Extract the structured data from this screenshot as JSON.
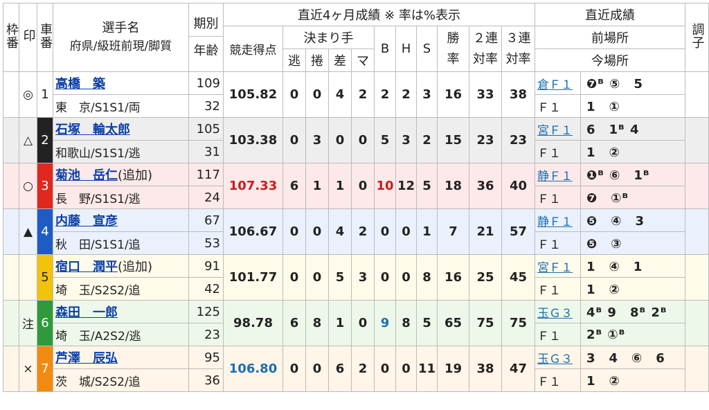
{
  "header": {
    "waku": "枠番",
    "shirushi": "印",
    "shaban": "車番",
    "name_top": "選手名",
    "name_bottom": "府県/級班前現/脚質",
    "kibetsu": "期別",
    "nenrei": "年齢",
    "recent4": "直近4ヶ月成績 ※ 率は%表示",
    "score": "競走得点",
    "kimarite": "決まり手",
    "nige": "逃",
    "makuri": "捲",
    "sashi": "差",
    "mark": "マ",
    "b": "B",
    "h": "H",
    "s": "S",
    "win_top": "勝",
    "win_bottom": "率",
    "ren2_top": "２連",
    "ren2_bottom": "対率",
    "ren3_top": "３連",
    "ren3_bottom": "対率",
    "recent_results": "直近成績",
    "prev_venue": "前場所",
    "this_venue": "今場所",
    "condition": "調子"
  },
  "colors": {
    "car1": "#ffffff",
    "car2": "#222222",
    "car3": "#e0281e",
    "car4": "#1e5bc6",
    "car5": "#f2c20d",
    "car6": "#2e9a3c",
    "car7": "#f28a12",
    "row1": "#ffffff",
    "row2": "#eeeeee",
    "row3": "#fde9e9",
    "row4": "#eaf1fc",
    "row5": "#fffbea",
    "row6": "#eef8ea",
    "row7": "#fff5e8"
  },
  "riders": [
    {
      "mark": "◎",
      "car": "1",
      "name": "高橋　築",
      "extra": "",
      "pref": "東　京/S1S1/両",
      "period": "109",
      "age": "32",
      "score": "105.82",
      "nige": "0",
      "makuri": "0",
      "sashi": "4",
      "mk": "2",
      "b": "2",
      "h": "2",
      "s": "3",
      "win": "16",
      "ren2": "33",
      "ren3": "38",
      "prev_track": "倉Ｆ１",
      "prev_rec": "❼ᴮ ⑤　5",
      "cur_track": "Ｆ１",
      "cur_rec": "1　①"
    },
    {
      "mark": "△",
      "car": "2",
      "name": "石塚　輪太郎",
      "extra": "",
      "pref": "和歌山/S1S1/逃",
      "period": "105",
      "age": "31",
      "score": "103.38",
      "nige": "0",
      "makuri": "3",
      "sashi": "0",
      "mk": "0",
      "b": "5",
      "h": "3",
      "s": "2",
      "win": "15",
      "ren2": "23",
      "ren3": "23",
      "prev_track": "宮Ｆ１",
      "prev_rec": "6　1ᴮ 4",
      "cur_track": "Ｆ１",
      "cur_rec": "1　②"
    },
    {
      "mark": "○",
      "car": "3",
      "name": "菊池　岳仁",
      "extra": "(追加)",
      "pref": "長　野/S1S1/逃",
      "period": "117",
      "age": "24",
      "score": "107.33",
      "nige": "6",
      "makuri": "1",
      "sashi": "1",
      "mk": "0",
      "b": "10",
      "h": "12",
      "s": "5",
      "win": "18",
      "ren2": "36",
      "ren3": "40",
      "prev_track": "静Ｆ１",
      "prev_rec": "❶ᴮ ⑥　1ᴮ",
      "cur_track": "Ｆ１",
      "cur_rec": "❼　①ᴮ"
    },
    {
      "mark": "▲",
      "car": "4",
      "name": "内藤　宣彦",
      "extra": "",
      "pref": "秋　田/S1S1/追",
      "period": "67",
      "age": "53",
      "score": "106.67",
      "nige": "0",
      "makuri": "0",
      "sashi": "4",
      "mk": "2",
      "b": "0",
      "h": "0",
      "s": "1",
      "win": "7",
      "ren2": "21",
      "ren3": "57",
      "prev_track": "静Ｆ１",
      "prev_rec": "❺　④　3",
      "cur_track": "Ｆ１",
      "cur_rec": "❺　③"
    },
    {
      "mark": "",
      "car": "5",
      "name": "宿口　潤平",
      "extra": "(追加)",
      "pref": "埼　玉/S2S2/追",
      "period": "91",
      "age": "42",
      "score": "101.77",
      "nige": "0",
      "makuri": "0",
      "sashi": "5",
      "mk": "3",
      "b": "0",
      "h": "0",
      "s": "8",
      "win": "16",
      "ren2": "25",
      "ren3": "45",
      "prev_track": "宮Ｆ１",
      "prev_rec": "1　④　1",
      "cur_track": "Ｆ１",
      "cur_rec": "1　②"
    },
    {
      "mark": "注",
      "car": "6",
      "name": "森田　一郎",
      "extra": "",
      "pref": "埼　玉/A2S2/逃",
      "period": "125",
      "age": "23",
      "score": "98.78",
      "nige": "6",
      "makuri": "8",
      "sashi": "1",
      "mk": "0",
      "b": "9",
      "h": "8",
      "s": "5",
      "win": "65",
      "ren2": "75",
      "ren3": "75",
      "prev_track": "玉Ｇ３",
      "prev_rec": "4ᴮ 9　8ᴮ 2ᴮ",
      "cur_track": "Ｆ１",
      "cur_rec": "2ᴮ ①ᴮ"
    },
    {
      "mark": "×",
      "car": "7",
      "name": "芦澤　辰弘",
      "extra": "",
      "pref": "茨　城/S2S2/追",
      "period": "95",
      "age": "36",
      "score": "106.80",
      "nige": "0",
      "makuri": "0",
      "sashi": "6",
      "mk": "2",
      "b": "0",
      "h": "0",
      "s": "11",
      "win": "19",
      "ren2": "38",
      "ren3": "47",
      "prev_track": "玉Ｇ３",
      "prev_rec": "3　4　⑥　6",
      "cur_track": "Ｆ１",
      "cur_rec": "1　②"
    }
  ]
}
